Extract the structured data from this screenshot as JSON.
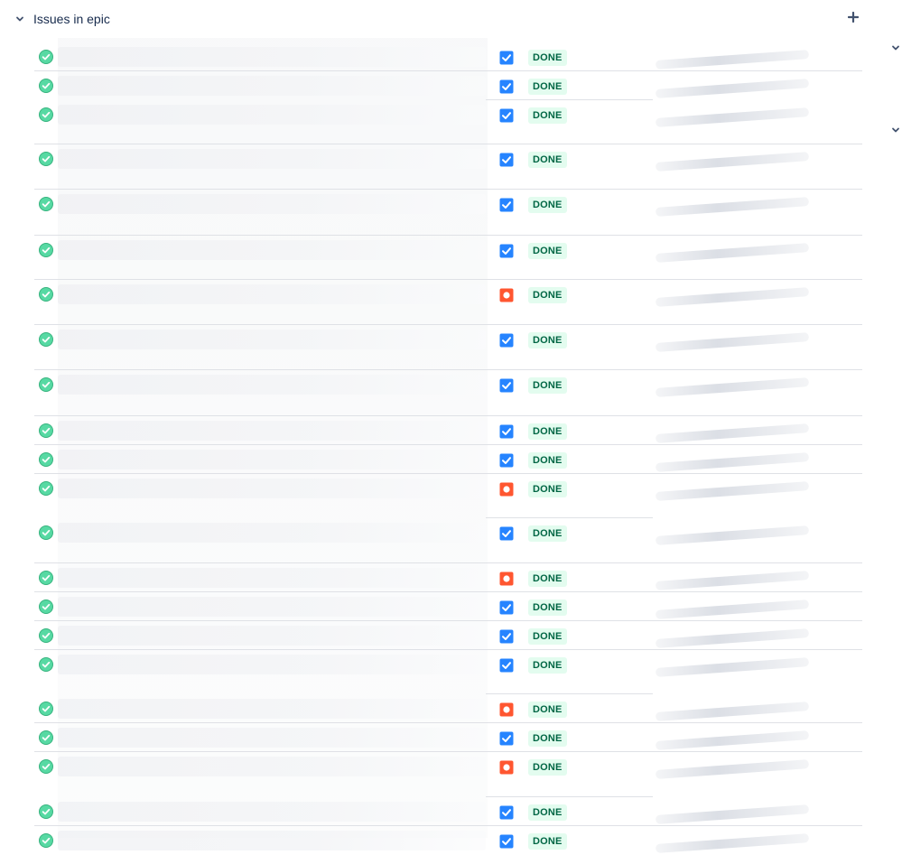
{
  "section": {
    "title": "Issues in epic",
    "add_icon": "plus-icon",
    "collapse_icon": "chevron-down-icon"
  },
  "colors": {
    "done_bg": "#e3fcef",
    "done_text": "#006644",
    "task_blue": "#2684ff",
    "bug_red": "#ff5630",
    "resolved_green": "#57d9a3"
  },
  "issues": [
    {
      "status": "DONE",
      "type": "task"
    },
    {
      "status": "DONE",
      "type": "task"
    },
    {
      "status": "DONE",
      "type": "task"
    },
    {
      "status": "DONE",
      "type": "task"
    },
    {
      "status": "DONE",
      "type": "task"
    },
    {
      "status": "DONE",
      "type": "task"
    },
    {
      "status": "DONE",
      "type": "bug"
    },
    {
      "status": "DONE",
      "type": "task"
    },
    {
      "status": "DONE",
      "type": "task"
    },
    {
      "status": "DONE",
      "type": "task"
    },
    {
      "status": "DONE",
      "type": "task"
    },
    {
      "status": "DONE",
      "type": "bug"
    },
    {
      "status": "DONE",
      "type": "task"
    },
    {
      "status": "DONE",
      "type": "bug"
    },
    {
      "status": "DONE",
      "type": "task"
    },
    {
      "status": "DONE",
      "type": "task"
    },
    {
      "status": "DONE",
      "type": "task"
    },
    {
      "status": "DONE",
      "type": "bug"
    },
    {
      "status": "DONE",
      "type": "task"
    },
    {
      "status": "DONE",
      "type": "bug"
    },
    {
      "status": "DONE",
      "type": "task"
    },
    {
      "status": "DONE",
      "type": "task"
    }
  ]
}
